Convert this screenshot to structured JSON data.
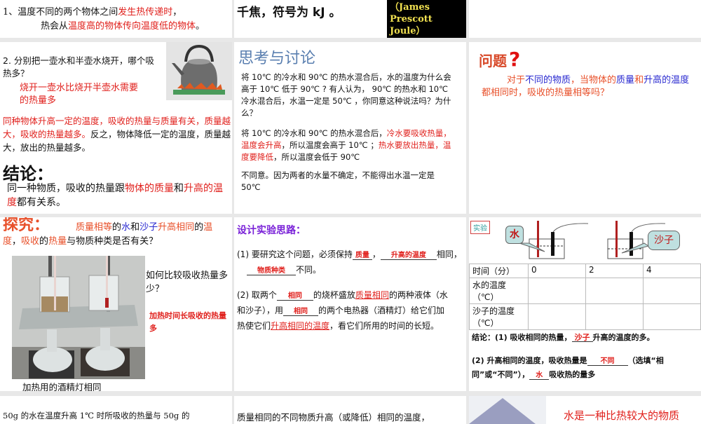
{
  "slides": {
    "s1": {
      "line1a": "1、温度不同的两个物体之间",
      "line1b": "发生热传递时",
      "line1c": "，",
      "line2a": "热会从",
      "line2b": "温度高的物体传向温度低的物体",
      "line2c": "。"
    },
    "s2": {
      "text": "千焦，符号为 kJ 。",
      "caption": "（James Prescott Joule）"
    },
    "s4": {
      "q1": "2. 分别把一壶水和半壶水烧开，哪个吸热多？",
      "a1": "烧开一壶水比烧开半壶水需要的热量多",
      "p_red": "同种物体升高一定的温度，吸收的热量与质量有关，质量越大，吸收的热量越多。",
      "p_black": "反之，物体降低一定的温度，质量越大，放出的热量越多。",
      "title": "结论：",
      "c1": "同一种物质，吸收的热量跟",
      "c2": "物体的质量",
      "c3": "和",
      "c4": "升高的温度",
      "c5": "都有关系。"
    },
    "s5": {
      "title": "思考与讨论",
      "p1": "将 10℃ 的冷水和 90℃ 的热水混合后，水的温度为什么会高于 10℃ 低于 90℃ ? 有人认为， 90℃ 的热水和 10℃ 冷水混合后，水温一定是 50℃ ，你同意这种说法吗？为什么？",
      "p2a": "将 10℃ 的冷水和 90℃ 的热水混合后，",
      "p2b": "冷水要吸收热量，温度会升高",
      "p2c": "，所以温度会高于 10℃ ；",
      "p2d": "热水要放出热量，温度要降低",
      "p2e": "，所以温度会低于 90℃",
      "p3": "不同意。因为两者的水量不确定，不能得出水温一定是 50℃"
    },
    "s6": {
      "title": "问题",
      "qmark": "?",
      "t1": "对于",
      "t2": "不同的物质",
      "t3": "，当物体的",
      "t4": "质量",
      "t5": "和",
      "t6": "升高的温度",
      "t7": "都相同时，吸收的热量相等吗？"
    },
    "s7": {
      "title": "探究：",
      "h1": "质量相等",
      "h2": "的",
      "h3": "水",
      "h4": "和",
      "h5": "沙子",
      "h6": "升高相同",
      "h7": "的",
      "h8": "温度",
      "h9": "，",
      "h10": "吸收",
      "h11": "的",
      "h12": "热量",
      "h13": "与物质种类是否有关？",
      "q": "如何比较吸收热量多少？",
      "a": "加热时间长吸收的热量多",
      "caption": "加热用的酒精灯相同"
    },
    "s8": {
      "title": "设计实验思路：",
      "l1a": "(1) 要研究这个问题，必须保持",
      "f1": "质量",
      "l1b": "，",
      "f2": "升高的温度",
      "l1c": "相同，",
      "f3": "物质种类",
      "l1d": "不同。",
      "l2a": "(2) 取两个",
      "f4": "相同",
      "l2b": "的烧杯盛放",
      "l2c": "质量相同",
      "l2d": "的两种液体（水和沙子），用",
      "f5": "相同",
      "l2e": "的两个电热器（酒精灯）给它们加热使它们",
      "l2f": "升高相同的温度",
      "l2g": "，看它们所用的时间的长短。"
    },
    "s9": {
      "tag": "实验",
      "water": "水",
      "sand": "沙子",
      "table": {
        "headers": [
          "时间（分）",
          "0",
          "2",
          "4"
        ],
        "rows": [
          [
            "水的温度（℃）",
            "",
            "",
            ""
          ],
          [
            "沙子的温度（℃）",
            "",
            "",
            ""
          ]
        ]
      },
      "c1a": "结论：(1) 吸收相同的热量，",
      "c1f": "沙子",
      "c1b": "升高的温度的多。",
      "c2a": "(2) 升高相同的温度，吸收热量是",
      "c2f": "不同",
      "c2b": "（选填“相同”或“不同”），",
      "c2f2": "水",
      "c2c": "吸收热的量多"
    },
    "s10": {
      "text": "50g 的水在温度升高 1℃ 时所吸收的热量与 50g 的"
    },
    "s11": {
      "text": "质量相同的不同物质升高（或降低）相同的温度，"
    },
    "s12": {
      "text": "水是一种比热较大的物质"
    }
  },
  "colors": {
    "red": "#e0201c",
    "blue": "#2a2ad0",
    "purple": "#7a22d8",
    "title_blue": "#5a7fb0",
    "caption_bg": "#000000",
    "caption_fg": "#f0e050"
  }
}
